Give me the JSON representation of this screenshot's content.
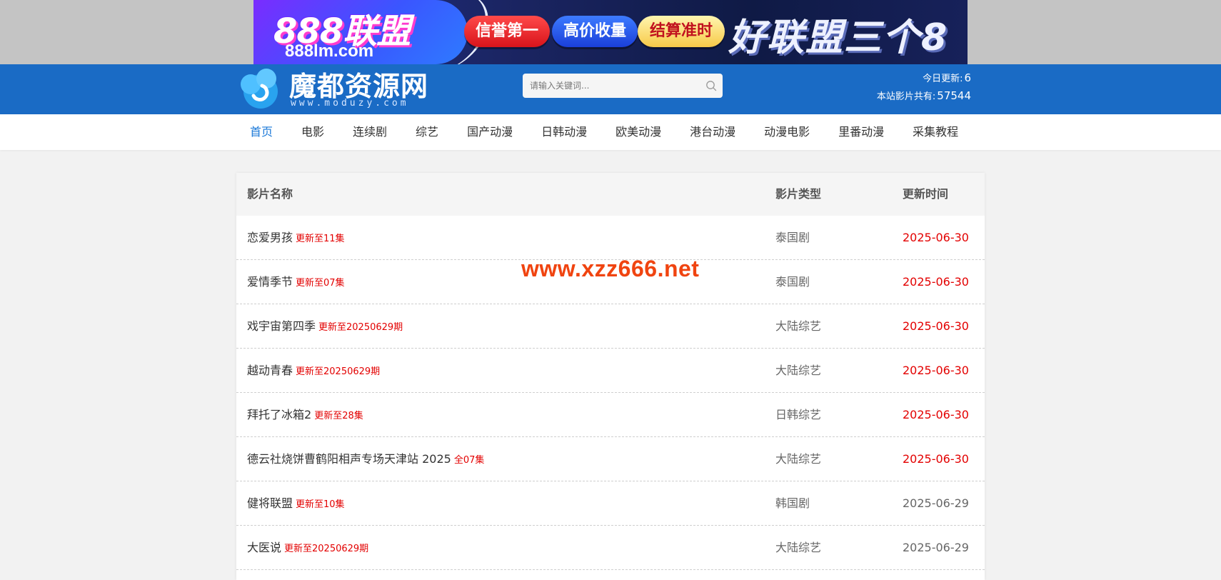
{
  "ad": {
    "brand": "888联盟",
    "domain": "888lm.com",
    "pills": [
      "信誉第一",
      "高价收量",
      "结算准时"
    ],
    "slogan": "好联盟三个8"
  },
  "header": {
    "logo_title": "魔都资源网",
    "logo_sub": "www.moduzy.com",
    "search_placeholder": "请输入关键词...",
    "today_label": "今日更新:",
    "today_count": "6",
    "total_label": "本站影片共有:",
    "total_count": "57544"
  },
  "nav": {
    "items": [
      "首页",
      "电影",
      "连续剧",
      "综艺",
      "国产动漫",
      "日韩动漫",
      "欧美动漫",
      "港台动漫",
      "动漫电影",
      "里番动漫",
      "采集教程"
    ]
  },
  "table": {
    "headers": {
      "title": "影片名称",
      "type": "影片类型",
      "date": "更新时间"
    },
    "rows": [
      {
        "title": "恋爱男孩",
        "note": "更新至11集",
        "type": "泰国剧",
        "date": "2025-06-30"
      },
      {
        "title": "爱情季节",
        "note": "更新至07集",
        "type": "泰国剧",
        "date": "2025-06-30"
      },
      {
        "title": "戏宇宙第四季",
        "note": "更新至20250629期",
        "type": "大陆综艺",
        "date": "2025-06-30"
      },
      {
        "title": "越动青春",
        "note": "更新至20250629期",
        "type": "大陆综艺",
        "date": "2025-06-30"
      },
      {
        "title": "拜托了冰箱2",
        "note": "更新至28集",
        "type": "日韩综艺",
        "date": "2025-06-30"
      },
      {
        "title": "德云社烧饼曹鹤阳相声专场天津站 2025",
        "note": "全07集",
        "type": "大陆综艺",
        "date": "2025-06-30"
      },
      {
        "title": "健将联盟",
        "note": "更新至10集",
        "type": "韩国剧",
        "date": "2025-06-29"
      },
      {
        "title": "大医说",
        "note": "更新至20250629期",
        "type": "大陆综艺",
        "date": "2025-06-29"
      }
    ]
  },
  "watermark": "www.xzz666.net",
  "colors": {
    "header_blue": "#1a6bc5",
    "nav_active": "#1a78d8",
    "highlight_red": "#e30000",
    "watermark": "#f04410"
  }
}
